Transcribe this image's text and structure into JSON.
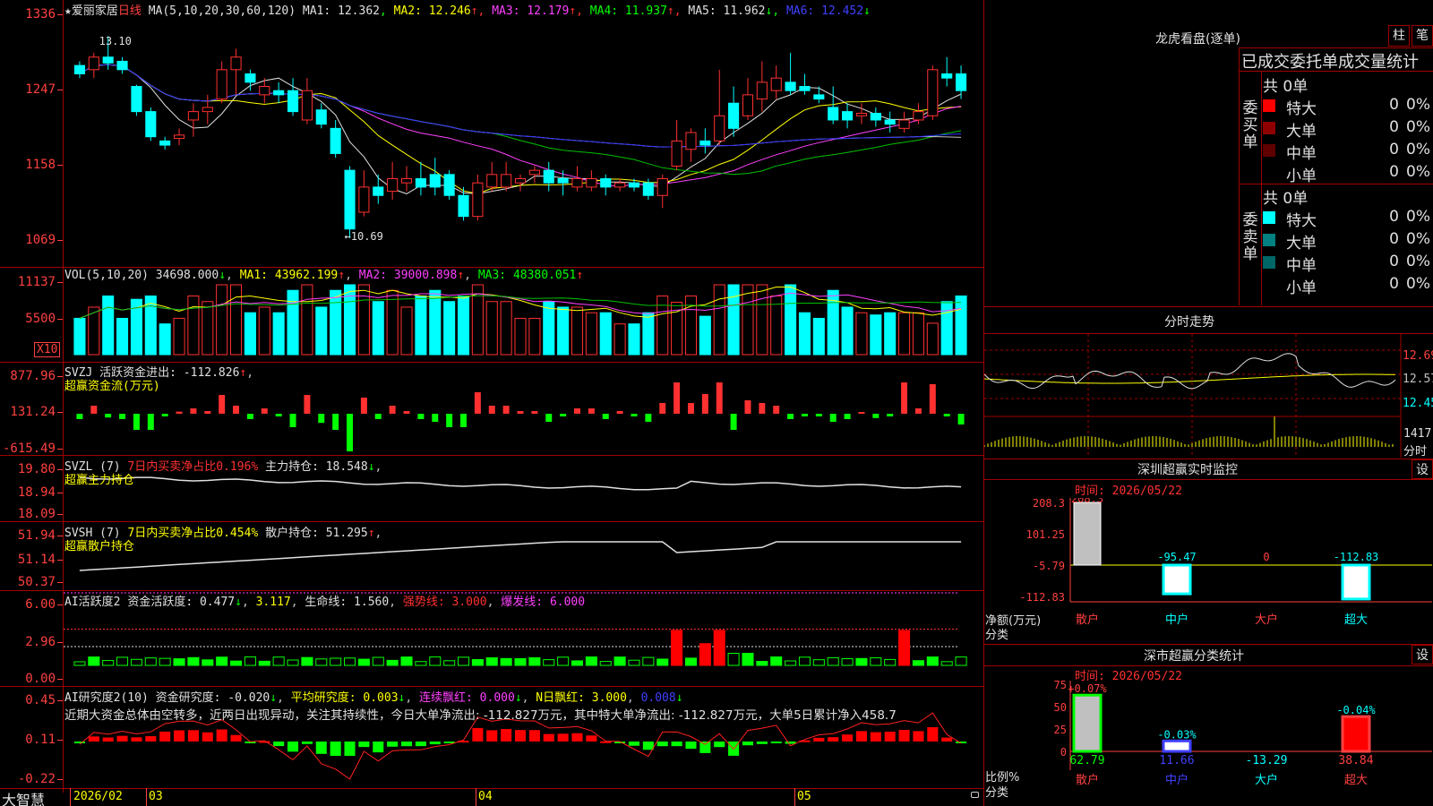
{
  "stock": {
    "name": "爱丽家居",
    "period": "日线",
    "ma_params": "MA(5,10,20,30,60,120)",
    "ma": [
      {
        "label": "MA1: 12.362",
        "arrow": "",
        "color": "#e0e0e0"
      },
      {
        "label": "MA2: 12.246",
        "arrow": "↑",
        "color": "#ffff00"
      },
      {
        "label": "MA3: 12.179",
        "arrow": "↑",
        "color": "#ff40ff"
      },
      {
        "label": "MA4: 11.937",
        "arrow": "↑",
        "color": "#00ff00"
      },
      {
        "label": "MA5: 11.962",
        "arrow": "↓",
        "color": "#e0e0e0"
      },
      {
        "label": "MA6: 12.452",
        "arrow": "↓",
        "color": "#4040ff"
      }
    ],
    "high_label": "13.10",
    "low_label": "←10.69"
  },
  "axes": {
    "price": [
      "1336",
      "1247",
      "1158",
      "1069"
    ],
    "vol": [
      "11137",
      "5500"
    ],
    "vol_unit": "X10",
    "svzj": [
      "877.96",
      "131.24",
      "-615.49"
    ],
    "svzl": [
      "19.80",
      "18.94",
      "18.09"
    ],
    "svsh": [
      "51.94",
      "51.14",
      "50.37"
    ],
    "ai": [
      "6.00",
      "2.96",
      "0.00"
    ],
    "research": [
      "0.45",
      "0.11",
      "-0.22"
    ]
  },
  "vol_title": {
    "name": "VOL(5,10,20)",
    "value": "34698.000",
    "arrow": "↓",
    "ma1": "MA1: 43962.199",
    "ma2": "MA2: 39000.898",
    "ma3": "MA3: 48380.051"
  },
  "svzj_title": {
    "name": "SVZJ",
    "label": "活跃资金进出: -112.826",
    "arrow": "↑",
    "sub": "超赢资金流(万元)"
  },
  "svzl_title": {
    "name": "SVZL (7)",
    "ratio": "7日内买卖净占比0.196%",
    "hold": "主力持仓: 18.548",
    "arrow": "↓",
    "sub": "超赢主力持仓"
  },
  "svsh_title": {
    "name": "SVSH (7)",
    "ratio": "7日内买卖净占比0.454%",
    "hold": "散户持仓: 51.295",
    "arrow": "↑",
    "sub": "超赢散户持仓"
  },
  "ai_title": {
    "name": "AI活跃度2",
    "a": "资金活跃度: 0.477",
    "a_arrow": "↓",
    "b": "3.117",
    "c": "生命线: 1.560",
    "d": "强势线: 3.000",
    "e": "爆发线: 6.000"
  },
  "research_title": {
    "name": "AI研究度2(10)",
    "a": "资金研究度: -0.020",
    "a_arrow": "↓",
    "b": "平均研究度: 0.003",
    "b_arrow": "↓",
    "c": "连续飘红: 0.000",
    "c_arrow": "↓",
    "d": "N日飘红: 3.000",
    "e": "0.008",
    "e_arrow": "↓"
  },
  "commentary": "近期大资金总体由空转多，近两日出现异动，关注其持续性，今日大单净流出: -112.827万元，其中特大单净流出: -112.827万元，大单5日累计净入458.7",
  "timeline": {
    "year": "2026/02",
    "months": [
      "03",
      "04",
      "05"
    ]
  },
  "brand": "大智慧",
  "right": {
    "lhkp_title": "龙虎看盘(逐单)",
    "btn1": "柱",
    "btn2": "笔",
    "subtitle": "已成交委托单成交量统计",
    "buy": {
      "side": "委买单",
      "total": "共 0单",
      "rows": [
        {
          "label": "特大",
          "v": "0",
          "p": "0%",
          "color": "#ff0000"
        },
        {
          "label": "大单",
          "v": "0",
          "p": "0%",
          "color": "#900000"
        },
        {
          "label": "中单",
          "v": "0",
          "p": "0%",
          "color": "#600000"
        },
        {
          "label": "小单",
          "v": "0",
          "p": "0%",
          "color": "#000000"
        }
      ]
    },
    "sell": {
      "side": "委卖单",
      "total": "共 0单",
      "rows": [
        {
          "label": "特大",
          "v": "0",
          "p": "0%",
          "color": "#00ffff"
        },
        {
          "label": "大单",
          "v": "0",
          "p": "0%",
          "color": "#008080"
        },
        {
          "label": "中单",
          "v": "0",
          "p": "0%",
          "color": "#006666"
        },
        {
          "label": "小单",
          "v": "0",
          "p": "0%",
          "color": "#000000"
        }
      ]
    },
    "intraday": {
      "title": "分时走势",
      "levels": [
        "12.69",
        "12.57",
        "12.45"
      ],
      "vol": "1417",
      "vol_unit": "分时"
    },
    "monitor": {
      "title": "深圳超赢实时监控",
      "btn": "设",
      "date": "时间: 2026/05/22",
      "axis": [
        "208.3",
        "101.25",
        "-5.79",
        "-112.83"
      ],
      "bottom_label": "净额(万元)",
      "cat_label": "分类",
      "cats": [
        "散户",
        "中户",
        "大户",
        "超大"
      ],
      "values": [
        "208.3",
        "-95.47",
        "0",
        "-112.83"
      ]
    },
    "stat": {
      "title": "深市超赢分类统计",
      "btn": "设",
      "date": "时间: 2026/05/22",
      "axis": [
        "75",
        "50",
        "25",
        "0"
      ],
      "bottom_label": "比例%",
      "cat_label": "分类",
      "cats": [
        "散户",
        "中户",
        "大户",
        "超大"
      ],
      "top": [
        "+0.07%",
        "-0.03%",
        "",
        "-0.04%"
      ],
      "bottom": [
        "62.79",
        "11.66",
        "-13.29",
        "38.84"
      ]
    }
  },
  "chart_data": {
    "type": "candlestick",
    "price_series": [
      [
        12.75,
        12.65,
        12.8,
        12.6
      ],
      [
        12.7,
        12.85,
        12.9,
        12.6
      ],
      [
        12.85,
        12.78,
        13.1,
        12.7
      ],
      [
        12.8,
        12.7,
        12.85,
        12.65
      ],
      [
        12.5,
        12.2,
        12.52,
        12.15
      ],
      [
        12.2,
        11.9,
        12.25,
        11.85
      ],
      [
        11.85,
        11.8,
        11.9,
        11.75
      ],
      [
        11.88,
        11.92,
        12.0,
        11.8
      ],
      [
        12.1,
        12.2,
        12.3,
        11.9
      ],
      [
        12.2,
        12.25,
        12.4,
        12.05
      ],
      [
        12.35,
        12.7,
        12.8,
        12.3
      ],
      [
        12.7,
        12.85,
        12.95,
        12.4
      ],
      [
        12.65,
        12.55,
        12.7,
        12.45
      ],
      [
        12.4,
        12.5,
        12.6,
        12.3
      ],
      [
        12.45,
        12.4,
        12.55,
        12.3
      ],
      [
        12.45,
        12.2,
        12.6,
        12.15
      ],
      [
        12.1,
        12.45,
        12.6,
        12.05
      ],
      [
        12.22,
        12.05,
        12.3,
        12.0
      ],
      [
        12.0,
        11.7,
        12.1,
        11.65
      ],
      [
        11.5,
        10.8,
        11.55,
        10.69
      ],
      [
        11.0,
        11.3,
        11.5,
        10.95
      ],
      [
        11.3,
        11.2,
        11.45,
        11.1
      ],
      [
        11.25,
        11.4,
        11.6,
        11.15
      ],
      [
        11.35,
        11.4,
        11.55,
        11.25
      ],
      [
        11.4,
        11.3,
        11.6,
        11.2
      ],
      [
        11.45,
        11.3,
        11.65,
        11.2
      ],
      [
        11.45,
        11.2,
        11.5,
        11.15
      ],
      [
        11.2,
        10.95,
        11.3,
        10.9
      ],
      [
        10.95,
        11.35,
        11.45,
        10.9
      ],
      [
        11.3,
        11.45,
        11.6,
        11.25
      ],
      [
        11.3,
        11.45,
        11.6,
        11.25
      ],
      [
        11.35,
        11.4,
        11.45,
        11.25
      ],
      [
        11.45,
        11.5,
        11.55,
        11.35
      ],
      [
        11.5,
        11.35,
        11.6,
        11.25
      ],
      [
        11.4,
        11.35,
        11.5,
        11.2
      ],
      [
        11.3,
        11.4,
        11.55,
        11.25
      ],
      [
        11.3,
        11.4,
        11.5,
        11.25
      ],
      [
        11.4,
        11.3,
        11.45,
        11.2
      ],
      [
        11.3,
        11.35,
        11.4,
        11.25
      ],
      [
        11.35,
        11.3,
        11.4,
        11.25
      ],
      [
        11.35,
        11.2,
        11.4,
        11.15
      ],
      [
        11.2,
        11.4,
        11.45,
        11.05
      ],
      [
        11.55,
        11.85,
        12.1,
        11.5
      ],
      [
        11.75,
        11.95,
        12.0,
        11.6
      ],
      [
        11.85,
        11.8,
        12.0,
        11.7
      ],
      [
        11.85,
        12.15,
        12.7,
        11.8
      ],
      [
        12.3,
        12.0,
        12.5,
        11.9
      ],
      [
        12.15,
        12.4,
        12.6,
        12.1
      ],
      [
        12.35,
        12.55,
        12.8,
        12.2
      ],
      [
        12.45,
        12.6,
        12.75,
        12.35
      ],
      [
        12.55,
        12.45,
        12.9,
        12.4
      ],
      [
        12.5,
        12.45,
        12.65,
        12.4
      ],
      [
        12.4,
        12.35,
        12.5,
        12.3
      ],
      [
        12.25,
        12.1,
        12.5,
        12.05
      ],
      [
        12.2,
        12.1,
        12.3,
        12.0
      ],
      [
        12.15,
        12.18,
        12.3,
        12.05
      ],
      [
        12.18,
        12.1,
        12.25,
        12.02
      ],
      [
        12.1,
        12.05,
        12.2,
        11.95
      ],
      [
        12.0,
        12.1,
        12.2,
        11.95
      ],
      [
        12.1,
        12.2,
        12.3,
        12.05
      ],
      [
        12.15,
        12.7,
        12.75,
        12.1
      ],
      [
        12.65,
        12.6,
        12.85,
        12.5
      ],
      [
        12.65,
        12.45,
        12.75,
        12.35
      ]
    ],
    "x_labels": [
      "2026/02",
      "03",
      "04",
      "05"
    ]
  }
}
